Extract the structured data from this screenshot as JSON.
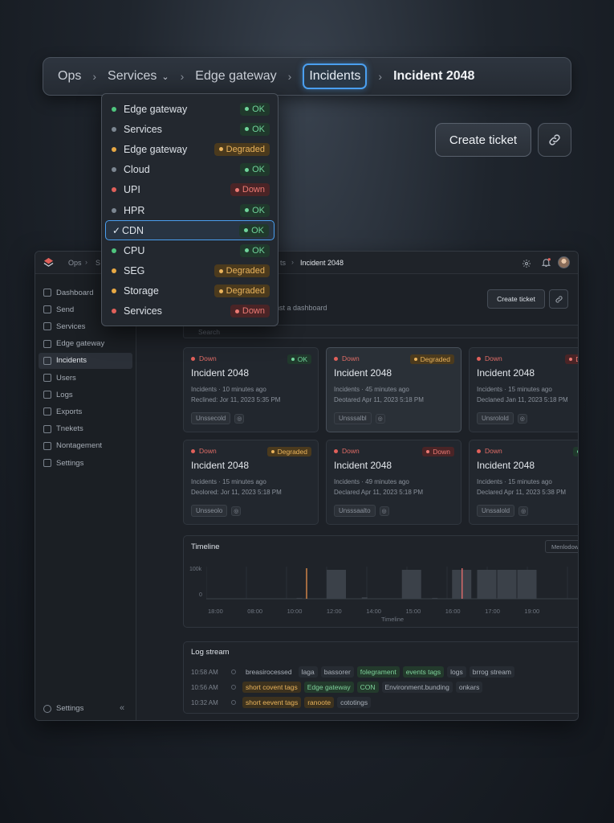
{
  "breadcrumb": {
    "items": [
      "Ops",
      "Services",
      "Edge gateway",
      "Incidents"
    ],
    "current": "Incident 2048"
  },
  "actions": {
    "create_ticket": "Create ticket"
  },
  "dropdown": {
    "items": [
      {
        "label": "Edge gateway",
        "status": "OK",
        "dot": "green"
      },
      {
        "label": "Services",
        "status": "OK",
        "dot": "gray"
      },
      {
        "label": "Edge gateway",
        "status": "Degraded",
        "dot": "amber"
      },
      {
        "label": "Cloud",
        "status": "OK",
        "dot": "gray"
      },
      {
        "label": "UPI",
        "status": "Down",
        "dot": "red"
      },
      {
        "label": "HPR",
        "status": "OK",
        "dot": "gray"
      },
      {
        "label": "CDN",
        "status": "OK",
        "dot": "none",
        "selected": true
      },
      {
        "label": "CPU",
        "status": "OK",
        "dot": "green"
      },
      {
        "label": "SEG",
        "status": "Degraded",
        "dot": "amber"
      },
      {
        "label": "Storage",
        "status": "Degraded",
        "dot": "amber"
      },
      {
        "label": "Services",
        "status": "Down",
        "dot": "red"
      }
    ]
  },
  "app": {
    "breadcrumb": {
      "first": "Ops",
      "second": "S",
      "tail": "ts",
      "current": "Incident 2048"
    },
    "sidebar": {
      "items": [
        "Dashboard",
        "Send",
        "Services",
        "Edge gateway",
        "Incidents",
        "Users",
        "Logs",
        "Exports",
        "Tnekets",
        "Nontagement",
        "Settings"
      ],
      "active": "Incidents",
      "footer": "Settings",
      "collapse": "«"
    },
    "subtitle_tail": "nst a dashboard",
    "create_ticket": "Create ticket",
    "search_placeholder": "Search",
    "cards": [
      {
        "status": "Down",
        "badge": "OK",
        "badge_type": "ok",
        "title": "Incident 2048",
        "m1": "Incidents · 10 minutes ago",
        "m2": "Reclined: Jor 11, 2023 5:35 PM",
        "chip": "Unssecold"
      },
      {
        "status": "Down",
        "badge": "Degraded",
        "badge_type": "deg",
        "title": "Incident 2048",
        "m1": "Incidents · 45 minutes ago",
        "m2": "Deotared Apr 11, 2023 5:18 PM",
        "chip": "Unsssalbl",
        "highlight": true
      },
      {
        "status": "Down",
        "badge": "Down",
        "badge_type": "down",
        "title": "Incident 2048",
        "m1": "Incidents · 15 minutes ago",
        "m2": "Declaned Jan 11, 2023 5:18 PM",
        "chip": "Unsrolold"
      },
      {
        "status": "Down",
        "badge": "Degraded",
        "badge_type": "deg",
        "title": "Incident 2048",
        "m1": "Incidents · 15 minutes ago",
        "m2": "Deolored: Jor 11, 2023 5:18 PM",
        "chip": "Unsseolo"
      },
      {
        "status": "Down",
        "badge": "Down",
        "badge_type": "down",
        "title": "Incident 2048",
        "m1": "Incidents · 49 minutes ago",
        "m2": "Declared Apr 11, 2023 5:18 PM",
        "chip": "Unsssaalto"
      },
      {
        "status": "Down",
        "badge": "OK",
        "badge_type": "ok",
        "title": "Incident 2048",
        "m1": "Incidents · 15 minutes ago",
        "m2": "Declared Apr 11, 2023 5:38 PM",
        "chip": "Unssalold"
      }
    ],
    "timeline": {
      "title": "Timeline",
      "dropdown": "Menlodown",
      "xlabel": "Timeline",
      "y_top": "100k",
      "y_bottom": "0"
    },
    "log": {
      "title": "Log stream",
      "more": "···",
      "rows": [
        {
          "time": "10:58 AM",
          "tags": [
            {
              "t": "breasirocessed",
              "k": "p"
            },
            {
              "t": "laga",
              "k": "n"
            },
            {
              "t": "bassorer",
              "k": "n"
            },
            {
              "t": "folegrament",
              "k": "g"
            },
            {
              "t": "events tags",
              "k": "g"
            },
            {
              "t": "logs",
              "k": "n"
            },
            {
              "t": "brrog stream",
              "k": "n"
            }
          ]
        },
        {
          "time": "10:56 AM",
          "tags": [
            {
              "t": "short covent tags",
              "k": "o"
            },
            {
              "t": "Edge gateway",
              "k": "g"
            },
            {
              "t": "CON",
              "k": "g"
            },
            {
              "t": "Environment.bunding",
              "k": "n"
            },
            {
              "t": "onkars",
              "k": "n"
            }
          ]
        },
        {
          "time": "10:32 AM",
          "tags": [
            {
              "t": "short eevent tags",
              "k": "o"
            },
            {
              "t": "ranoote",
              "k": "o"
            },
            {
              "t": "cototings",
              "k": "n"
            }
          ]
        }
      ]
    }
  },
  "chart_data": {
    "type": "bar",
    "title": "Timeline",
    "xlabel": "Timeline",
    "ylabel": "",
    "x_ticks": [
      "18:00",
      "08:00",
      "10:00",
      "12:00",
      "14:00",
      "15:00",
      "16:00",
      "17:00",
      "19:00"
    ],
    "y_ticks": [
      "100k",
      "0"
    ],
    "ylim": [
      0,
      100000
    ],
    "bars": [
      {
        "x": "10:00",
        "value": 3000
      },
      {
        "x": "11:00",
        "value": 100000
      },
      {
        "x": "12:10",
        "value": 5000
      },
      {
        "x": "13:30",
        "value": 100000
      },
      {
        "x": "14:30",
        "value": 3000
      },
      {
        "x": "15:10",
        "value": 100000
      },
      {
        "x": "16:00",
        "value": 100000
      },
      {
        "x": "16:40",
        "value": 100000
      },
      {
        "x": "17:20",
        "value": 100000
      }
    ],
    "markers": [
      {
        "x": "10:20",
        "color": "#d98a4a"
      },
      {
        "x": "15:30",
        "color": "#e06c6c"
      }
    ],
    "colors": {
      "bars": "#3b4149"
    }
  }
}
